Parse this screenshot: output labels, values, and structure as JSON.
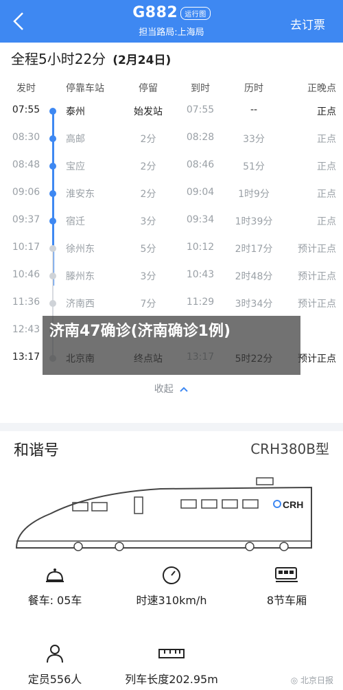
{
  "header": {
    "back": "back",
    "train_no": "G882",
    "badge": "运行图",
    "route": "担当路局:上海局",
    "action": "去订票"
  },
  "schedule": {
    "summary": "全程5小时22分",
    "date": "(2月24日)",
    "columns": [
      "发时",
      "停靠车站",
      "停留",
      "到时",
      "历时",
      "正晚点"
    ],
    "rows": [
      {
        "dep": "07:55",
        "station": "泰州",
        "stay": "始发站",
        "arr": "07:55",
        "dur": "--",
        "punc": "正点"
      },
      {
        "dep": "08:30",
        "station": "高邮",
        "stay": "2分",
        "arr": "08:28",
        "dur": "33分",
        "punc": "正点"
      },
      {
        "dep": "08:48",
        "station": "宝应",
        "stay": "2分",
        "arr": "08:46",
        "dur": "51分",
        "punc": "正点"
      },
      {
        "dep": "09:06",
        "station": "淮安东",
        "stay": "2分",
        "arr": "09:04",
        "dur": "1时9分",
        "punc": "正点"
      },
      {
        "dep": "09:37",
        "station": "宿迁",
        "stay": "3分",
        "arr": "09:34",
        "dur": "1时39分",
        "punc": "正点"
      },
      {
        "dep": "10:17",
        "station": "徐州东",
        "stay": "5分",
        "arr": "10:12",
        "dur": "2时17分",
        "punc": "预计正点"
      },
      {
        "dep": "10:46",
        "station": "滕州东",
        "stay": "3分",
        "arr": "10:43",
        "dur": "2时48分",
        "punc": "预计正点"
      },
      {
        "dep": "11:36",
        "station": "济南西",
        "stay": "7分",
        "arr": "11:29",
        "dur": "3时34分",
        "punc": "预计正点"
      },
      {
        "dep": "12:43",
        "station": "",
        "stay": "",
        "arr": "",
        "dur": "",
        "punc": ""
      },
      {
        "dep": "13:17",
        "station": "北京南",
        "stay": "终点站",
        "arr": "13:17",
        "dur": "5时22分",
        "punc": "预计正点"
      }
    ],
    "collapse": "收起"
  },
  "overlay": {
    "headline": "济南47确诊(济南确诊1例)"
  },
  "train": {
    "name": "和谐号",
    "model": "CRH380B型",
    "logo_text": "CRH",
    "features": [
      {
        "icon": "dining-icon",
        "label": "餐车: 05车"
      },
      {
        "icon": "speedometer-icon",
        "label": "时速310km/h"
      },
      {
        "icon": "train-car-icon",
        "label": "8节车厢"
      },
      {
        "icon": "person-icon",
        "label": "定员556人"
      },
      {
        "icon": "ruler-icon",
        "label": "列车长度202.95m"
      }
    ]
  },
  "watermark": "北京日报",
  "colors": {
    "accent": "#3e88f2"
  }
}
